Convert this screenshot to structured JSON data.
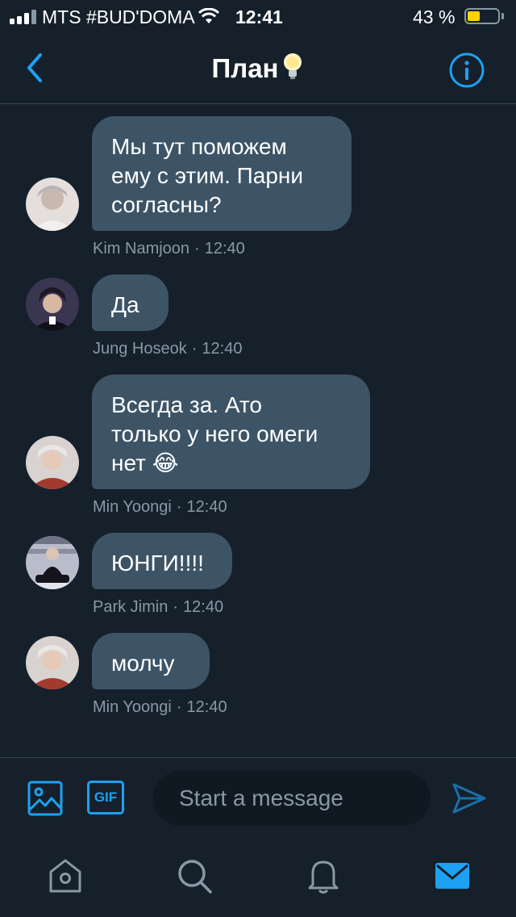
{
  "status_bar": {
    "carrier": "MTS #BUD'DOMA",
    "time": "12:41",
    "battery_percent_label": "43 %",
    "battery_level": 0.43
  },
  "header": {
    "title": "План",
    "back_icon": "chevron-left-icon",
    "info_icon": "info-icon",
    "title_icon": "lightbulb-icon"
  },
  "messages": [
    {
      "lines": [
        "Мы тут поможем",
        "ему с этим. Парни",
        "согласны?"
      ],
      "author": "Kim Namjoon",
      "time": "12:40",
      "avatar_color": "#d9d4d3"
    },
    {
      "lines": [
        "Да"
      ],
      "author": "Jung Hoseok",
      "time": "12:40",
      "avatar_color": "#2f2a3a"
    },
    {
      "lines": [
        "Всегда за. Ато",
        "только у него омеги",
        "нет"
      ],
      "emoji": "😂",
      "author": "Min Yoongi",
      "time": "12:40",
      "avatar_color": "#a33a2e"
    },
    {
      "lines": [
        "ЮНГИ!!!!"
      ],
      "author": "Park Jimin",
      "time": "12:40",
      "avatar_color": "#9aa0b5"
    },
    {
      "lines": [
        "молчу"
      ],
      "author": "Min Yoongi",
      "time": "12:40",
      "avatar_color": "#a33a2e"
    }
  ],
  "composer": {
    "placeholder": "Start a message",
    "gif_label": "GIF",
    "media_icon": "image-icon",
    "send_icon": "send-icon"
  },
  "tab_bar": {
    "items": [
      "home-icon",
      "search-icon",
      "bell-icon",
      "mail-icon"
    ],
    "active": "mail-icon"
  },
  "colors": {
    "background": "#15202b",
    "bubble": "#3d5466",
    "accent": "#1da1f2",
    "muted_text": "#8899a6"
  }
}
